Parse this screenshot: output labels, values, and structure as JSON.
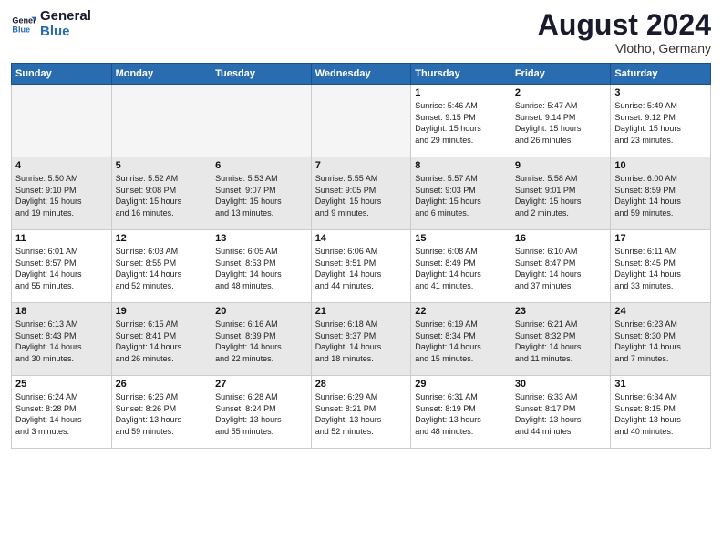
{
  "logo": {
    "line1": "General",
    "line2": "Blue"
  },
  "title": "August 2024",
  "location": "Vlotho, Germany",
  "days_of_week": [
    "Sunday",
    "Monday",
    "Tuesday",
    "Wednesday",
    "Thursday",
    "Friday",
    "Saturday"
  ],
  "weeks": [
    [
      {
        "day": "",
        "info": ""
      },
      {
        "day": "",
        "info": ""
      },
      {
        "day": "",
        "info": ""
      },
      {
        "day": "",
        "info": ""
      },
      {
        "day": "1",
        "info": "Sunrise: 5:46 AM\nSunset: 9:15 PM\nDaylight: 15 hours\nand 29 minutes."
      },
      {
        "day": "2",
        "info": "Sunrise: 5:47 AM\nSunset: 9:14 PM\nDaylight: 15 hours\nand 26 minutes."
      },
      {
        "day": "3",
        "info": "Sunrise: 5:49 AM\nSunset: 9:12 PM\nDaylight: 15 hours\nand 23 minutes."
      }
    ],
    [
      {
        "day": "4",
        "info": "Sunrise: 5:50 AM\nSunset: 9:10 PM\nDaylight: 15 hours\nand 19 minutes."
      },
      {
        "day": "5",
        "info": "Sunrise: 5:52 AM\nSunset: 9:08 PM\nDaylight: 15 hours\nand 16 minutes."
      },
      {
        "day": "6",
        "info": "Sunrise: 5:53 AM\nSunset: 9:07 PM\nDaylight: 15 hours\nand 13 minutes."
      },
      {
        "day": "7",
        "info": "Sunrise: 5:55 AM\nSunset: 9:05 PM\nDaylight: 15 hours\nand 9 minutes."
      },
      {
        "day": "8",
        "info": "Sunrise: 5:57 AM\nSunset: 9:03 PM\nDaylight: 15 hours\nand 6 minutes."
      },
      {
        "day": "9",
        "info": "Sunrise: 5:58 AM\nSunset: 9:01 PM\nDaylight: 15 hours\nand 2 minutes."
      },
      {
        "day": "10",
        "info": "Sunrise: 6:00 AM\nSunset: 8:59 PM\nDaylight: 14 hours\nand 59 minutes."
      }
    ],
    [
      {
        "day": "11",
        "info": "Sunrise: 6:01 AM\nSunset: 8:57 PM\nDaylight: 14 hours\nand 55 minutes."
      },
      {
        "day": "12",
        "info": "Sunrise: 6:03 AM\nSunset: 8:55 PM\nDaylight: 14 hours\nand 52 minutes."
      },
      {
        "day": "13",
        "info": "Sunrise: 6:05 AM\nSunset: 8:53 PM\nDaylight: 14 hours\nand 48 minutes."
      },
      {
        "day": "14",
        "info": "Sunrise: 6:06 AM\nSunset: 8:51 PM\nDaylight: 14 hours\nand 44 minutes."
      },
      {
        "day": "15",
        "info": "Sunrise: 6:08 AM\nSunset: 8:49 PM\nDaylight: 14 hours\nand 41 minutes."
      },
      {
        "day": "16",
        "info": "Sunrise: 6:10 AM\nSunset: 8:47 PM\nDaylight: 14 hours\nand 37 minutes."
      },
      {
        "day": "17",
        "info": "Sunrise: 6:11 AM\nSunset: 8:45 PM\nDaylight: 14 hours\nand 33 minutes."
      }
    ],
    [
      {
        "day": "18",
        "info": "Sunrise: 6:13 AM\nSunset: 8:43 PM\nDaylight: 14 hours\nand 30 minutes."
      },
      {
        "day": "19",
        "info": "Sunrise: 6:15 AM\nSunset: 8:41 PM\nDaylight: 14 hours\nand 26 minutes."
      },
      {
        "day": "20",
        "info": "Sunrise: 6:16 AM\nSunset: 8:39 PM\nDaylight: 14 hours\nand 22 minutes."
      },
      {
        "day": "21",
        "info": "Sunrise: 6:18 AM\nSunset: 8:37 PM\nDaylight: 14 hours\nand 18 minutes."
      },
      {
        "day": "22",
        "info": "Sunrise: 6:19 AM\nSunset: 8:34 PM\nDaylight: 14 hours\nand 15 minutes."
      },
      {
        "day": "23",
        "info": "Sunrise: 6:21 AM\nSunset: 8:32 PM\nDaylight: 14 hours\nand 11 minutes."
      },
      {
        "day": "24",
        "info": "Sunrise: 6:23 AM\nSunset: 8:30 PM\nDaylight: 14 hours\nand 7 minutes."
      }
    ],
    [
      {
        "day": "25",
        "info": "Sunrise: 6:24 AM\nSunset: 8:28 PM\nDaylight: 14 hours\nand 3 minutes."
      },
      {
        "day": "26",
        "info": "Sunrise: 6:26 AM\nSunset: 8:26 PM\nDaylight: 13 hours\nand 59 minutes."
      },
      {
        "day": "27",
        "info": "Sunrise: 6:28 AM\nSunset: 8:24 PM\nDaylight: 13 hours\nand 55 minutes."
      },
      {
        "day": "28",
        "info": "Sunrise: 6:29 AM\nSunset: 8:21 PM\nDaylight: 13 hours\nand 52 minutes."
      },
      {
        "day": "29",
        "info": "Sunrise: 6:31 AM\nSunset: 8:19 PM\nDaylight: 13 hours\nand 48 minutes."
      },
      {
        "day": "30",
        "info": "Sunrise: 6:33 AM\nSunset: 8:17 PM\nDaylight: 13 hours\nand 44 minutes."
      },
      {
        "day": "31",
        "info": "Sunrise: 6:34 AM\nSunset: 8:15 PM\nDaylight: 13 hours\nand 40 minutes."
      }
    ]
  ]
}
